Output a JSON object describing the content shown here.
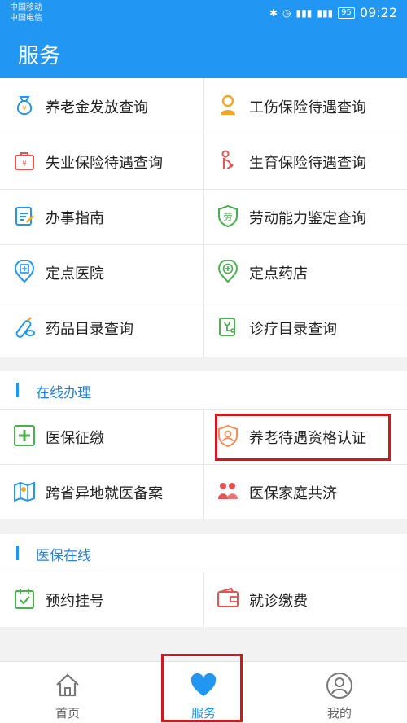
{
  "status": {
    "carrier1": "中国移动",
    "carrier2": "中国电信",
    "battery": "95",
    "time": "09:22"
  },
  "header": {
    "title": "服务"
  },
  "services": [
    {
      "label": "养老金发放查询",
      "icon": "money-bag-icon"
    },
    {
      "label": "工伤保险待遇查询",
      "icon": "person-icon"
    },
    {
      "label": "失业保险待遇查询",
      "icon": "briefcase-icon"
    },
    {
      "label": "生育保险待遇查询",
      "icon": "pregnancy-icon"
    },
    {
      "label": "办事指南",
      "icon": "clipboard-icon"
    },
    {
      "label": "劳动能力鉴定查询",
      "icon": "shield-badge-icon"
    },
    {
      "label": "定点医院",
      "icon": "hospital-pin-icon"
    },
    {
      "label": "定点药店",
      "icon": "pharmacy-pin-icon"
    },
    {
      "label": "药品目录查询",
      "icon": "pill-icon"
    },
    {
      "label": "诊疗目录查询",
      "icon": "medical-record-icon"
    }
  ],
  "online": {
    "title": "在线办理",
    "items": [
      {
        "label": "医保征缴",
        "icon": "plus-box-icon"
      },
      {
        "label": "养老待遇资格认证",
        "icon": "face-shield-icon"
      },
      {
        "label": "跨省异地就医备案",
        "icon": "map-icon"
      },
      {
        "label": "医保家庭共济",
        "icon": "family-icon"
      }
    ]
  },
  "medical_online": {
    "title": "医保在线",
    "items": [
      {
        "label": "预约挂号",
        "icon": "calendar-check-icon"
      },
      {
        "label": "就诊缴费",
        "icon": "wallet-icon"
      }
    ]
  },
  "tabs": [
    {
      "label": "首页",
      "icon": "home-icon"
    },
    {
      "label": "服务",
      "icon": "heart-icon"
    },
    {
      "label": "我的",
      "icon": "user-icon"
    }
  ],
  "colors": {
    "primary": "#2196f3",
    "highlight": "#d0161e"
  }
}
